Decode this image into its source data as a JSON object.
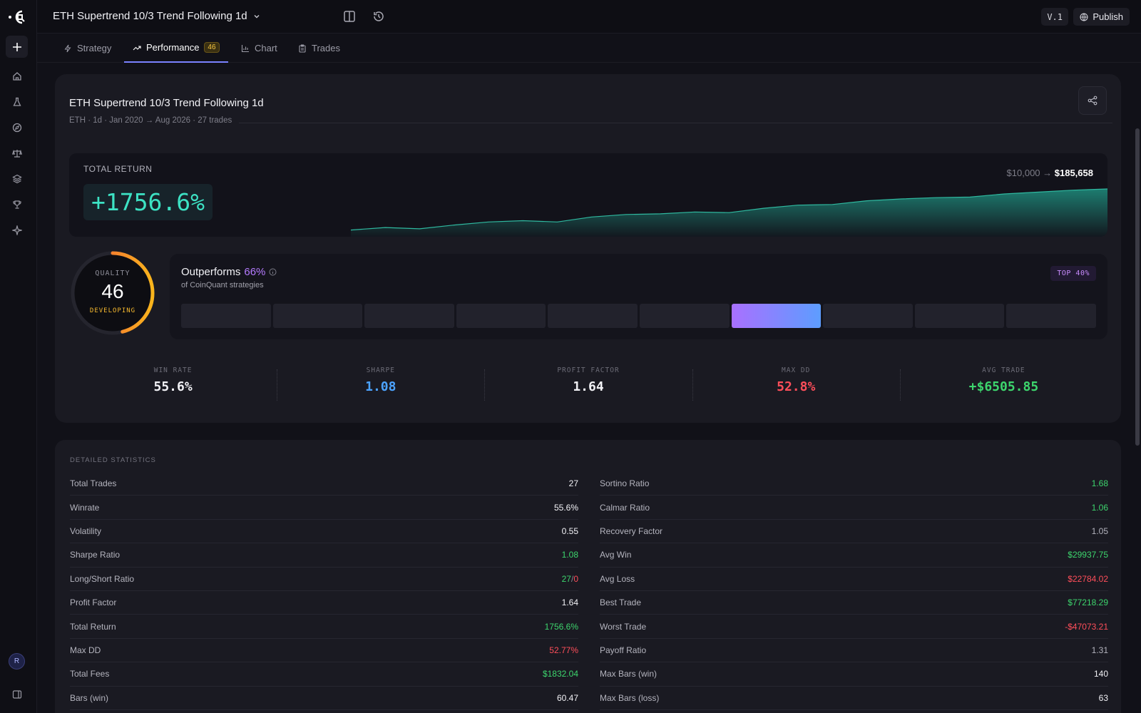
{
  "app": {
    "title": "ETH Supertrend 10/3 Trend Following 1d",
    "version": "V.1",
    "publish_label": "Publish"
  },
  "rail": {
    "avatar_initial": "R"
  },
  "tabs": [
    {
      "label": "Strategy"
    },
    {
      "label": "Performance",
      "badge": "46"
    },
    {
      "label": "Chart"
    },
    {
      "label": "Trades"
    }
  ],
  "card": {
    "title": "ETH Supertrend 10/3 Trend Following 1d",
    "subtitle": "ETH · 1d · Jan 2020 → Aug 2026 · 27 trades",
    "total_return_label": "TOTAL RETURN",
    "total_return_value": "+1756.6%",
    "capital_start": "$10,000 →",
    "capital_end": "$185,658",
    "equity_curve": [
      0.05,
      0.09,
      0.07,
      0.13,
      0.18,
      0.2,
      0.18,
      0.26,
      0.3,
      0.31,
      0.34,
      0.33,
      0.4,
      0.45,
      0.46,
      0.52,
      0.55,
      0.57,
      0.58,
      0.63,
      0.66,
      0.69,
      0.71
    ]
  },
  "quality": {
    "label": "QUALITY",
    "score": "46",
    "score_fraction": 0.46,
    "status": "DEVELOPING"
  },
  "outperform": {
    "title": "Outperforms",
    "percent": "66%",
    "subtitle": "of CoinQuant strategies",
    "badge": "TOP 40%",
    "bucket_count": 10,
    "active_bucket": 6
  },
  "metrics": [
    {
      "label": "WIN RATE",
      "value": "55.6%",
      "tone": ""
    },
    {
      "label": "SHARPE",
      "value": "1.08",
      "tone": "blue"
    },
    {
      "label": "PROFIT FACTOR",
      "value": "1.64",
      "tone": ""
    },
    {
      "label": "MAX DD",
      "value": "52.8%",
      "tone": "neg"
    },
    {
      "label": "AVG TRADE",
      "value": "+$6505.85",
      "tone": "pos"
    }
  ],
  "stats": {
    "heading": "DETAILED STATISTICS",
    "left": [
      {
        "k": "Total Trades",
        "v": "27",
        "tone": ""
      },
      {
        "k": "Winrate",
        "v": "55.6%",
        "tone": ""
      },
      {
        "k": "Volatility",
        "v": "0.55",
        "tone": ""
      },
      {
        "k": "Sharpe Ratio",
        "v": "1.08",
        "tone": "pos"
      },
      {
        "k": "Long/Short Ratio",
        "v": "27",
        "v2": "0",
        "tone": "split"
      },
      {
        "k": "Profit Factor",
        "v": "1.64",
        "tone": ""
      },
      {
        "k": "Total Return",
        "v": "1756.6%",
        "tone": "pos"
      },
      {
        "k": "Max DD",
        "v": "52.77%",
        "tone": "neg"
      },
      {
        "k": "Total Fees",
        "v": "$1832.04",
        "tone": "pos"
      },
      {
        "k": "Bars (win)",
        "v": "60.47",
        "tone": ""
      }
    ],
    "right": [
      {
        "k": "Sortino Ratio",
        "v": "1.68",
        "tone": "pos"
      },
      {
        "k": "Calmar Ratio",
        "v": "1.06",
        "tone": "pos"
      },
      {
        "k": "Recovery Factor",
        "v": "1.05",
        "tone": "muted"
      },
      {
        "k": "Avg Win",
        "v": "$29937.75",
        "tone": "pos"
      },
      {
        "k": "Avg Loss",
        "v": "$22784.02",
        "tone": "neg"
      },
      {
        "k": "Best Trade",
        "v": "$77218.29",
        "tone": "pos"
      },
      {
        "k": "Worst Trade",
        "v": "-$47073.21",
        "tone": "neg"
      },
      {
        "k": "Payoff Ratio",
        "v": "1.31",
        "tone": "muted"
      },
      {
        "k": "Max Bars (win)",
        "v": "140",
        "tone": ""
      },
      {
        "k": "Max Bars (loss)",
        "v": "63",
        "tone": ""
      }
    ]
  },
  "colors": {
    "accent": "#7b82ff",
    "positive": "#3dd56d",
    "negative": "#ff4e5a",
    "return": "#3de2c4",
    "equity": "#1f8f7f"
  }
}
